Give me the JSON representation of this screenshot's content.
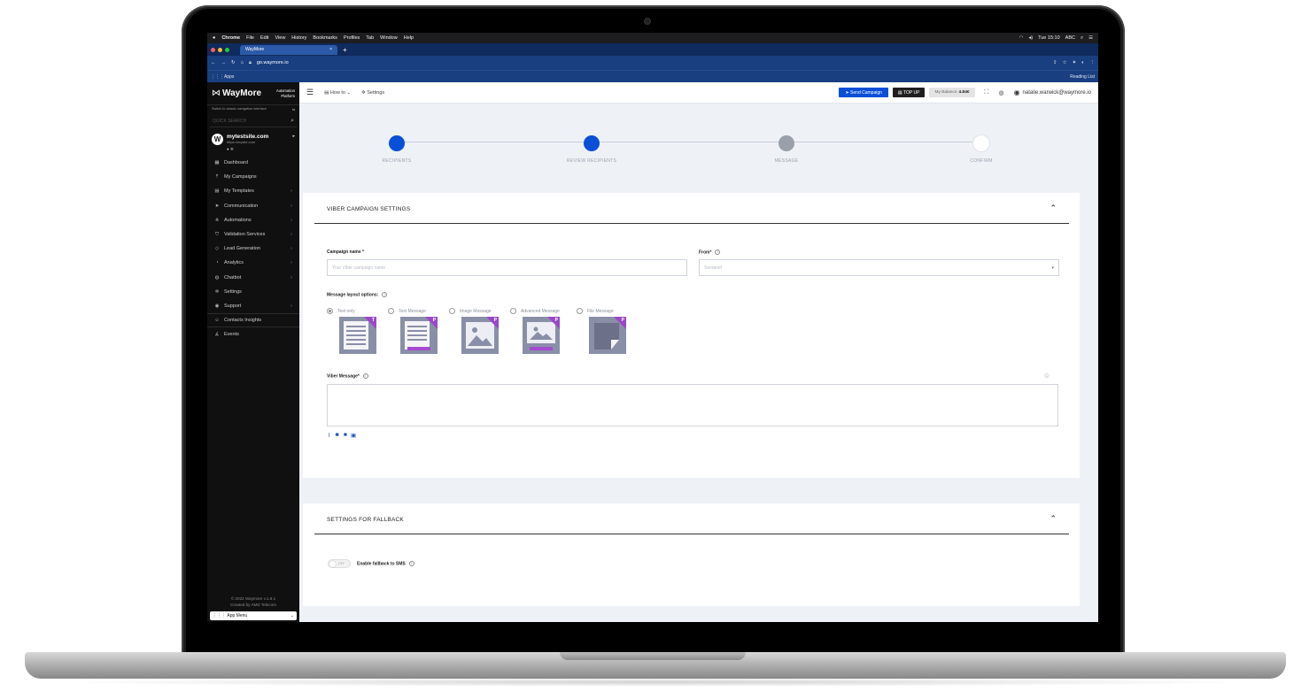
{
  "macbar": {
    "apple": "",
    "app": "Chrome",
    "menus": [
      "File",
      "Edit",
      "View",
      "History",
      "Bookmarks",
      "Profiles",
      "Tab",
      "Window",
      "Help"
    ],
    "time": "Tue 15:10",
    "lang": "ABC"
  },
  "browser": {
    "tab_title": "WayMore",
    "tab_close": "×",
    "new_tab": "+",
    "url": "go.waymore.io",
    "apps": "Apps",
    "reading_list": "Reading List"
  },
  "sidebar": {
    "brand": "WayMore",
    "platform_line1": "Automation",
    "platform_line2": "Platform",
    "switch_text": "Switch to classic navigation interface",
    "quick_search": "QUICK SEARCH",
    "site_name": "mytestsite.com",
    "site_url": "https://mysite.com",
    "items": [
      {
        "label": "Dashboard",
        "icon": "grid-icon",
        "glyph": "▦",
        "chevron": ""
      },
      {
        "label": "My Campaigns",
        "icon": "upload-icon",
        "glyph": "⤒",
        "chevron": ""
      },
      {
        "label": "My Templates",
        "icon": "template-icon",
        "glyph": "▤",
        "chevron": "›"
      },
      {
        "label": "Communication",
        "icon": "send-icon",
        "glyph": "➤",
        "chevron": "›"
      },
      {
        "label": "Automations",
        "icon": "flow-icon",
        "glyph": "⋔",
        "chevron": "›"
      },
      {
        "label": "Validation Services",
        "icon": "shield-icon",
        "glyph": "⛉",
        "chevron": "›"
      },
      {
        "label": "Lead Generation",
        "icon": "tag-icon",
        "glyph": "◇",
        "chevron": "›"
      },
      {
        "label": "Analytics",
        "icon": "chart-icon",
        "glyph": "◔",
        "chevron": "›"
      },
      {
        "label": "Chatbot",
        "icon": "bot-icon",
        "glyph": "◍",
        "chevron": "›"
      },
      {
        "label": "Settings",
        "icon": "gear-icon",
        "glyph": "✲",
        "chevron": ""
      },
      {
        "label": "Support",
        "icon": "lifebuoy-icon",
        "glyph": "◉",
        "chevron": "›"
      },
      {
        "label": "Contacts Insights",
        "icon": "contacts-icon",
        "glyph": "☺",
        "chevron": ""
      },
      {
        "label": "Events",
        "icon": "events-icon",
        "glyph": "∡",
        "chevron": ""
      }
    ],
    "copyright_1": "© 2022 Waymore v.1.8.1",
    "copyright_2": "Created by AMD Telecom",
    "app_menu": "App Menu"
  },
  "header": {
    "how_to": "How to",
    "settings": "Settings",
    "send_campaign": "Send Campaign",
    "top_up": "TOP UP",
    "balance_label": "My Balance",
    "balance_value": "4.84€",
    "user_email": "natalie.warwick@waymore.io"
  },
  "stepper": {
    "steps": [
      {
        "label": "RECIPIENTS",
        "color": "#0a4fd8"
      },
      {
        "label": "REVIEW RECIPIENTS",
        "color": "#0a4fd8"
      },
      {
        "label": "MESSAGE",
        "color": "#9aa0aa"
      },
      {
        "label": "CONFIRM",
        "color": "#ffffff"
      }
    ]
  },
  "viber": {
    "title": "VIBER CAMPAIGN SETTINGS",
    "campaign_name_label": "Campaign name *",
    "campaign_name_placeholder": "Your Viber campaign name",
    "from_label": "From*",
    "from_placeholder": "Senderid",
    "layout_label": "Message layout options:",
    "layouts": [
      {
        "label": "Text only",
        "badge": "T",
        "selected": true
      },
      {
        "label": "Text Message",
        "badge": "P",
        "selected": false
      },
      {
        "label": "Image Message",
        "badge": "P",
        "selected": false
      },
      {
        "label": "Advanced Message",
        "badge": "P",
        "selected": false
      },
      {
        "label": "File Message",
        "badge": "P",
        "selected": false
      }
    ],
    "message_label": "Viber Message*"
  },
  "fallback": {
    "title": "SETTINGS FOR FALLBACK",
    "toggle_state": "OFF",
    "toggle_label": "Enable fallback to SMS"
  },
  "colors": {
    "primary": "#0a4fd8",
    "purple": "#9a48c8",
    "sidebar_bg": "#101010",
    "chrome_bg": "#1a3f80"
  }
}
